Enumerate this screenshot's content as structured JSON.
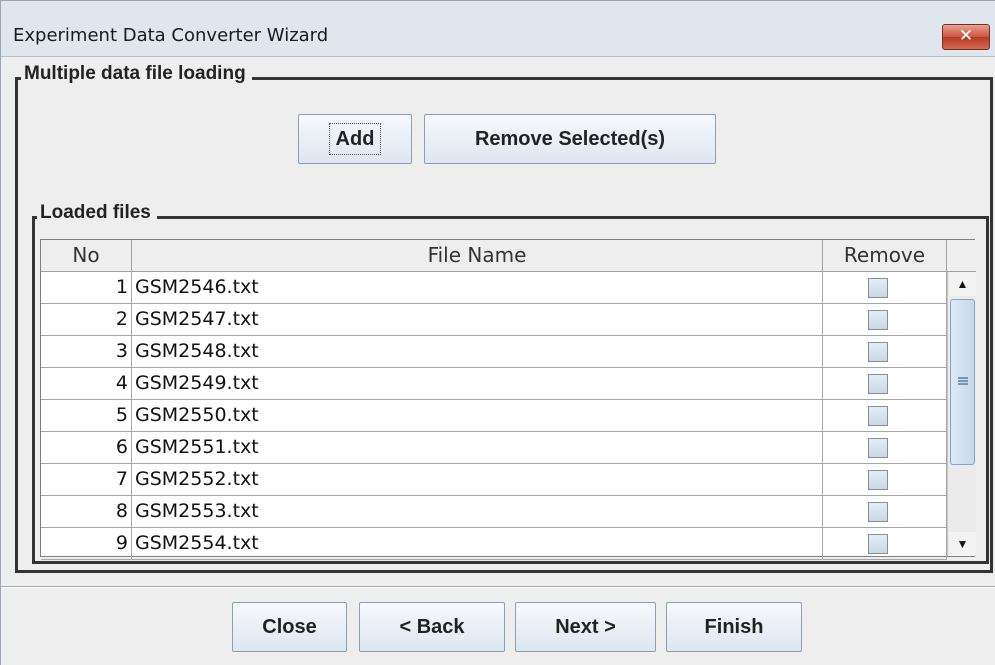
{
  "window": {
    "title": "Experiment Data Converter Wizard",
    "close_glyph": "✕"
  },
  "loading_panel": {
    "legend": "Multiple data file loading",
    "add_label": "Add",
    "remove_selected_label": "Remove Selected(s)"
  },
  "files_panel": {
    "legend": "Loaded files",
    "columns": [
      "No",
      "File Name",
      "Remove"
    ],
    "rows": [
      {
        "no": "1",
        "file": "GSM2546.txt",
        "remove": false
      },
      {
        "no": "2",
        "file": "GSM2547.txt",
        "remove": false
      },
      {
        "no": "3",
        "file": "GSM2548.txt",
        "remove": false
      },
      {
        "no": "4",
        "file": "GSM2549.txt",
        "remove": false
      },
      {
        "no": "5",
        "file": "GSM2550.txt",
        "remove": false
      },
      {
        "no": "6",
        "file": "GSM2551.txt",
        "remove": false
      },
      {
        "no": "7",
        "file": "GSM2552.txt",
        "remove": false
      },
      {
        "no": "8",
        "file": "GSM2553.txt",
        "remove": false
      },
      {
        "no": "9",
        "file": "GSM2554.txt",
        "remove": false
      }
    ],
    "scroll_up_glyph": "▲",
    "scroll_down_glyph": "▼"
  },
  "footer": {
    "close_label": "Close",
    "back_label": "< Back",
    "next_label": "Next >",
    "finish_label": "Finish"
  },
  "icons": {
    "close": "close-icon",
    "scroll_up": "arrow-up-icon",
    "scroll_down": "arrow-down-icon",
    "scroll_grip": "grip-icon"
  },
  "colors": {
    "window_bg": "#eeeeee",
    "title_close_button": "#c9543e",
    "button_gradient_top": "#f7f9fc",
    "button_gradient_bottom": "#dde6f0"
  }
}
